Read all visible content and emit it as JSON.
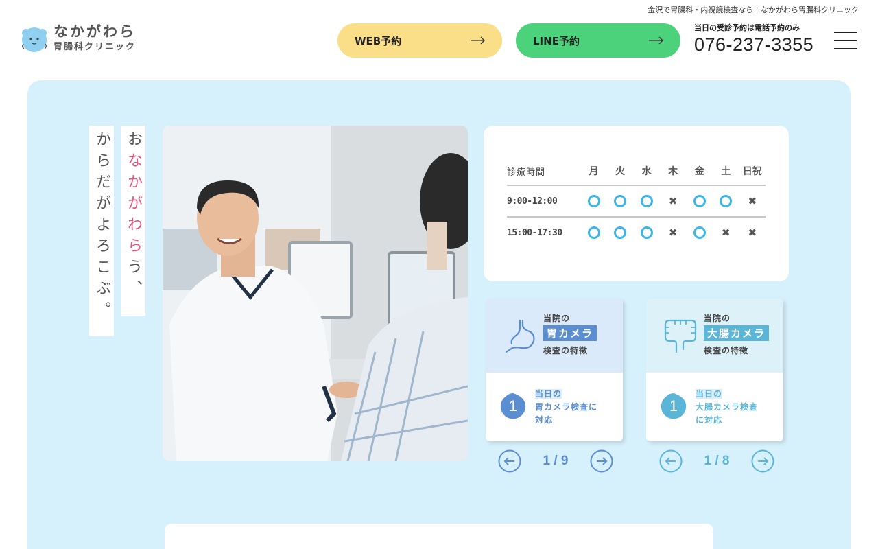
{
  "header": {
    "tagline": "金沢で胃腸科・内視鏡検査なら | なかがわら胃腸科クリニック",
    "logo_line1": "なかがわら",
    "logo_line2": "胃腸科クリニック",
    "web_button": "WEB予約",
    "line_button": "LINE予約",
    "phone_note": "当日の受診予約は電話予約のみ",
    "phone_number": "076-237-3355"
  },
  "hero": {
    "catch_col1_pre": "お",
    "catch_col1_pink": "なかがわら",
    "catch_col1_post": "う、",
    "catch_col2": "からだがよろこぶ。"
  },
  "schedule": {
    "header_label": "診療時間",
    "days": [
      "月",
      "火",
      "水",
      "木",
      "金",
      "土",
      "日祝"
    ],
    "rows": [
      {
        "time": "9:00-12:00",
        "marks": [
          "o",
          "o",
          "o",
          "x",
          "o",
          "o",
          "x"
        ]
      },
      {
        "time": "15:00-17:30",
        "marks": [
          "o",
          "o",
          "o",
          "x",
          "o",
          "x",
          "x"
        ]
      }
    ]
  },
  "cards": [
    {
      "pre": "当院の",
      "highlight": "胃カメラ",
      "post": "検査の特徴",
      "number": "1",
      "point_line1": "当日の",
      "point_line2": "胃カメラ検査に",
      "point_line3": "対応",
      "page": "1 / 9",
      "top_color": "#dbeafa",
      "accent": "#5b8ed0",
      "icon": "stomach-icon"
    },
    {
      "pre": "当院の",
      "highlight": "大腸カメラ",
      "post": "検査の特徴",
      "number": "1",
      "point_line1": "当日の",
      "point_line2": "大腸カメラ検査",
      "point_line3": "に対応",
      "page": "1 / 8",
      "top_color": "#ddf1f8",
      "accent": "#5bb5d6",
      "icon": "intestine-icon"
    }
  ],
  "colors": {
    "hero_bg": "#d6f0fc",
    "web_button": "#fade88",
    "line_button": "#4bd27a",
    "mark_circle": "#3bb5ea",
    "catch_pink": "#e5587e"
  }
}
